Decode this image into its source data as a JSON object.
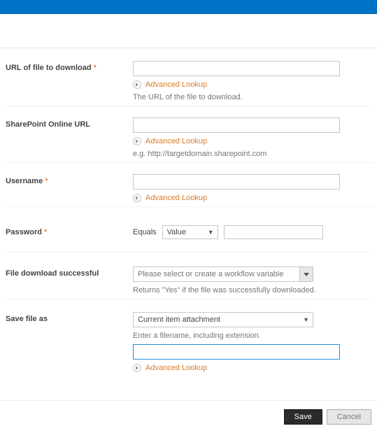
{
  "fields": {
    "url": {
      "label": "URL of file to download",
      "required": "*",
      "value": "",
      "advanced": "Advanced Lookup",
      "hint": "The URL of the file to download."
    },
    "sp_url": {
      "label": "SharePoint Online URL",
      "value": "",
      "advanced": "Advanced Lookup",
      "hint": "e.g. http://targetdomain.sharepoint.com"
    },
    "username": {
      "label": "Username",
      "required": "*",
      "value": "",
      "advanced": "Advanced Lookup"
    },
    "password": {
      "label": "Password",
      "required": "*",
      "eq_label": "Equals",
      "dropdown_value": "Value",
      "input_value": ""
    },
    "download_ok": {
      "label": "File download successful",
      "placeholder": "Please select or create a workflow variable",
      "hint": "Returns \"Yes\" if the file was successfully downloaded."
    },
    "save_as": {
      "label": "Save file as",
      "select_value": "Current item attachment",
      "hint": "Enter a filename, including extension.",
      "value": "",
      "advanced": "Advanced Lookup"
    }
  },
  "footer": {
    "save": "Save",
    "cancel": "Cancel"
  }
}
